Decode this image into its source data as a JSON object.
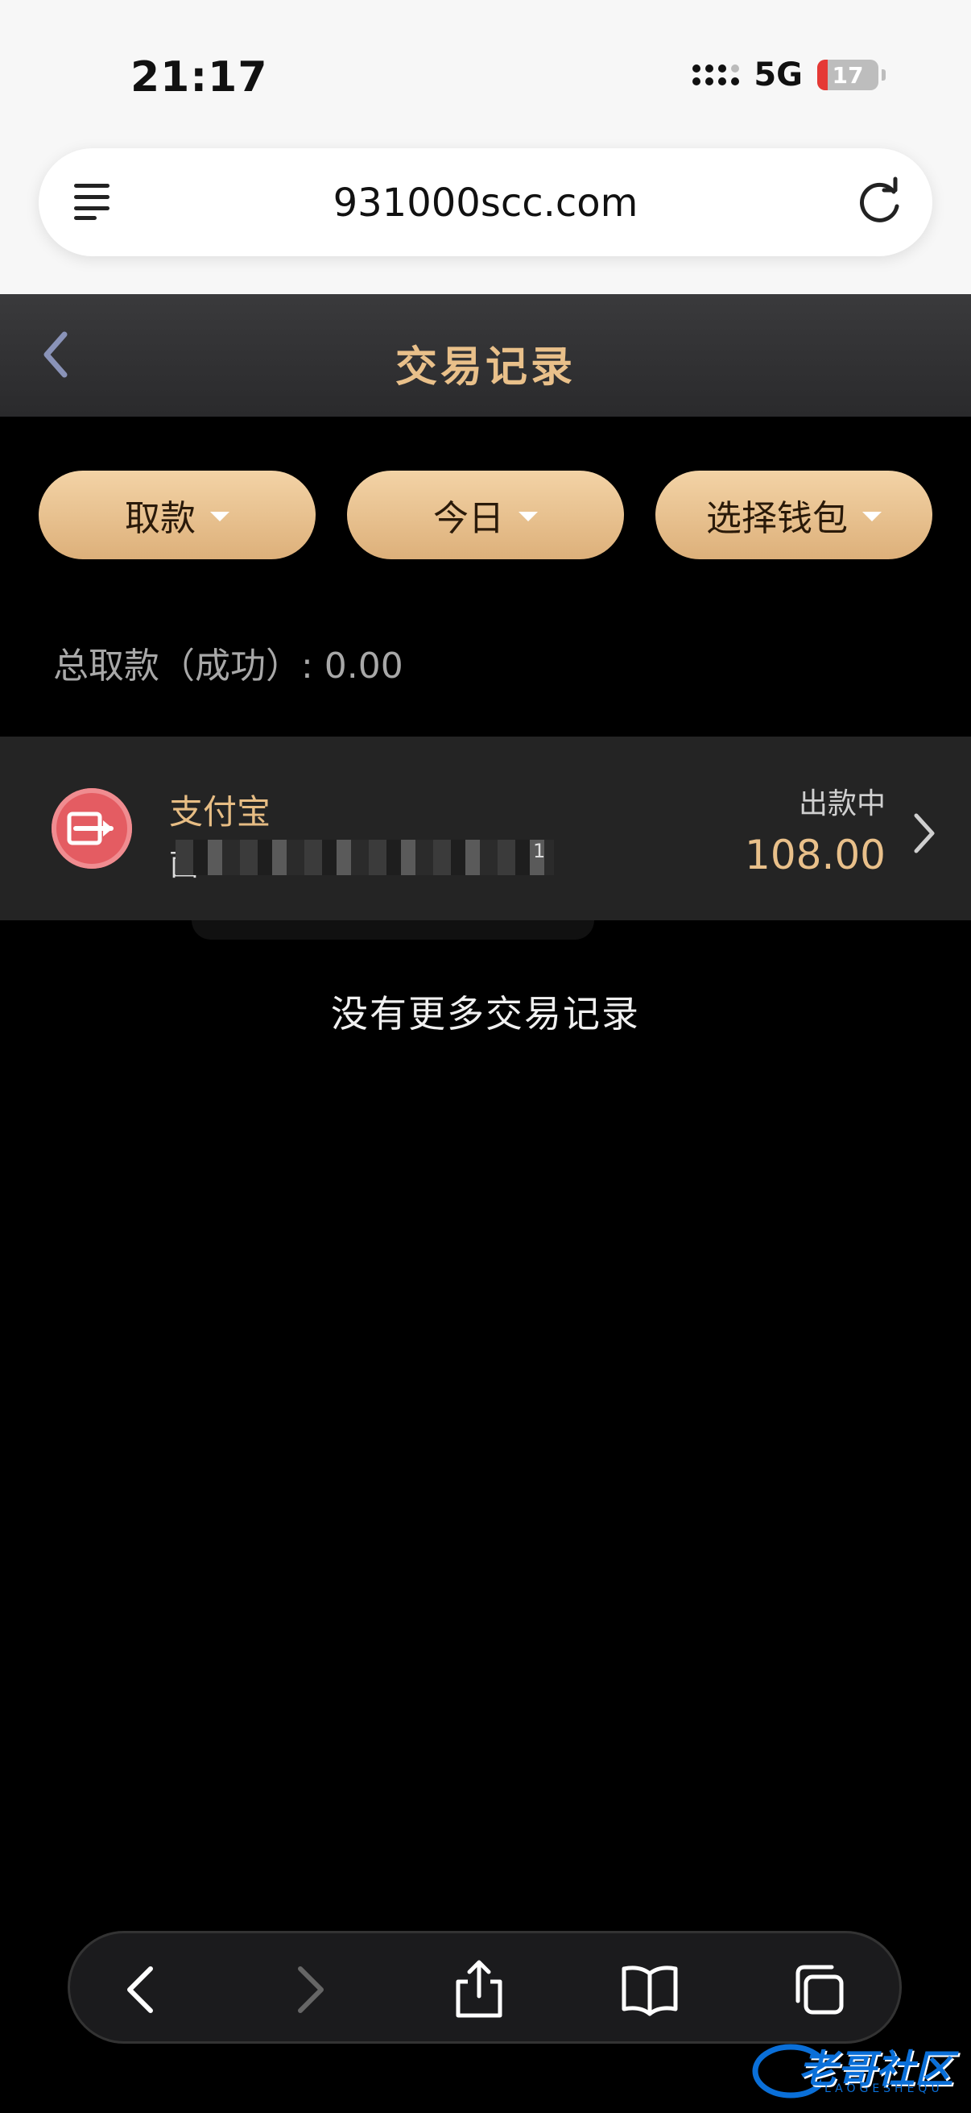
{
  "status_bar": {
    "time": "21:17",
    "network": "5G",
    "battery": "17",
    "battery_level": 0.17
  },
  "browser": {
    "url": "931000scc.com"
  },
  "header": {
    "title": "交易记录"
  },
  "filters": [
    {
      "label": "取款"
    },
    {
      "label": "今日"
    },
    {
      "label": "选择钱包"
    }
  ],
  "summary": {
    "total_label": "总取款（成功）: 0.00"
  },
  "record": {
    "name": "支付宝",
    "account_visible": "茵",
    "account_suffix": "1",
    "status": "出款中",
    "amount": "108.00"
  },
  "footer": {
    "no_more": "没有更多交易记录"
  },
  "watermark": {
    "text": "老哥社区",
    "sub": "LAOGESHEQU"
  },
  "colors": {
    "accent": "#e9c08a",
    "pill": "#e6bd88",
    "header_bg": "#323234",
    "record_bg": "#242424"
  }
}
